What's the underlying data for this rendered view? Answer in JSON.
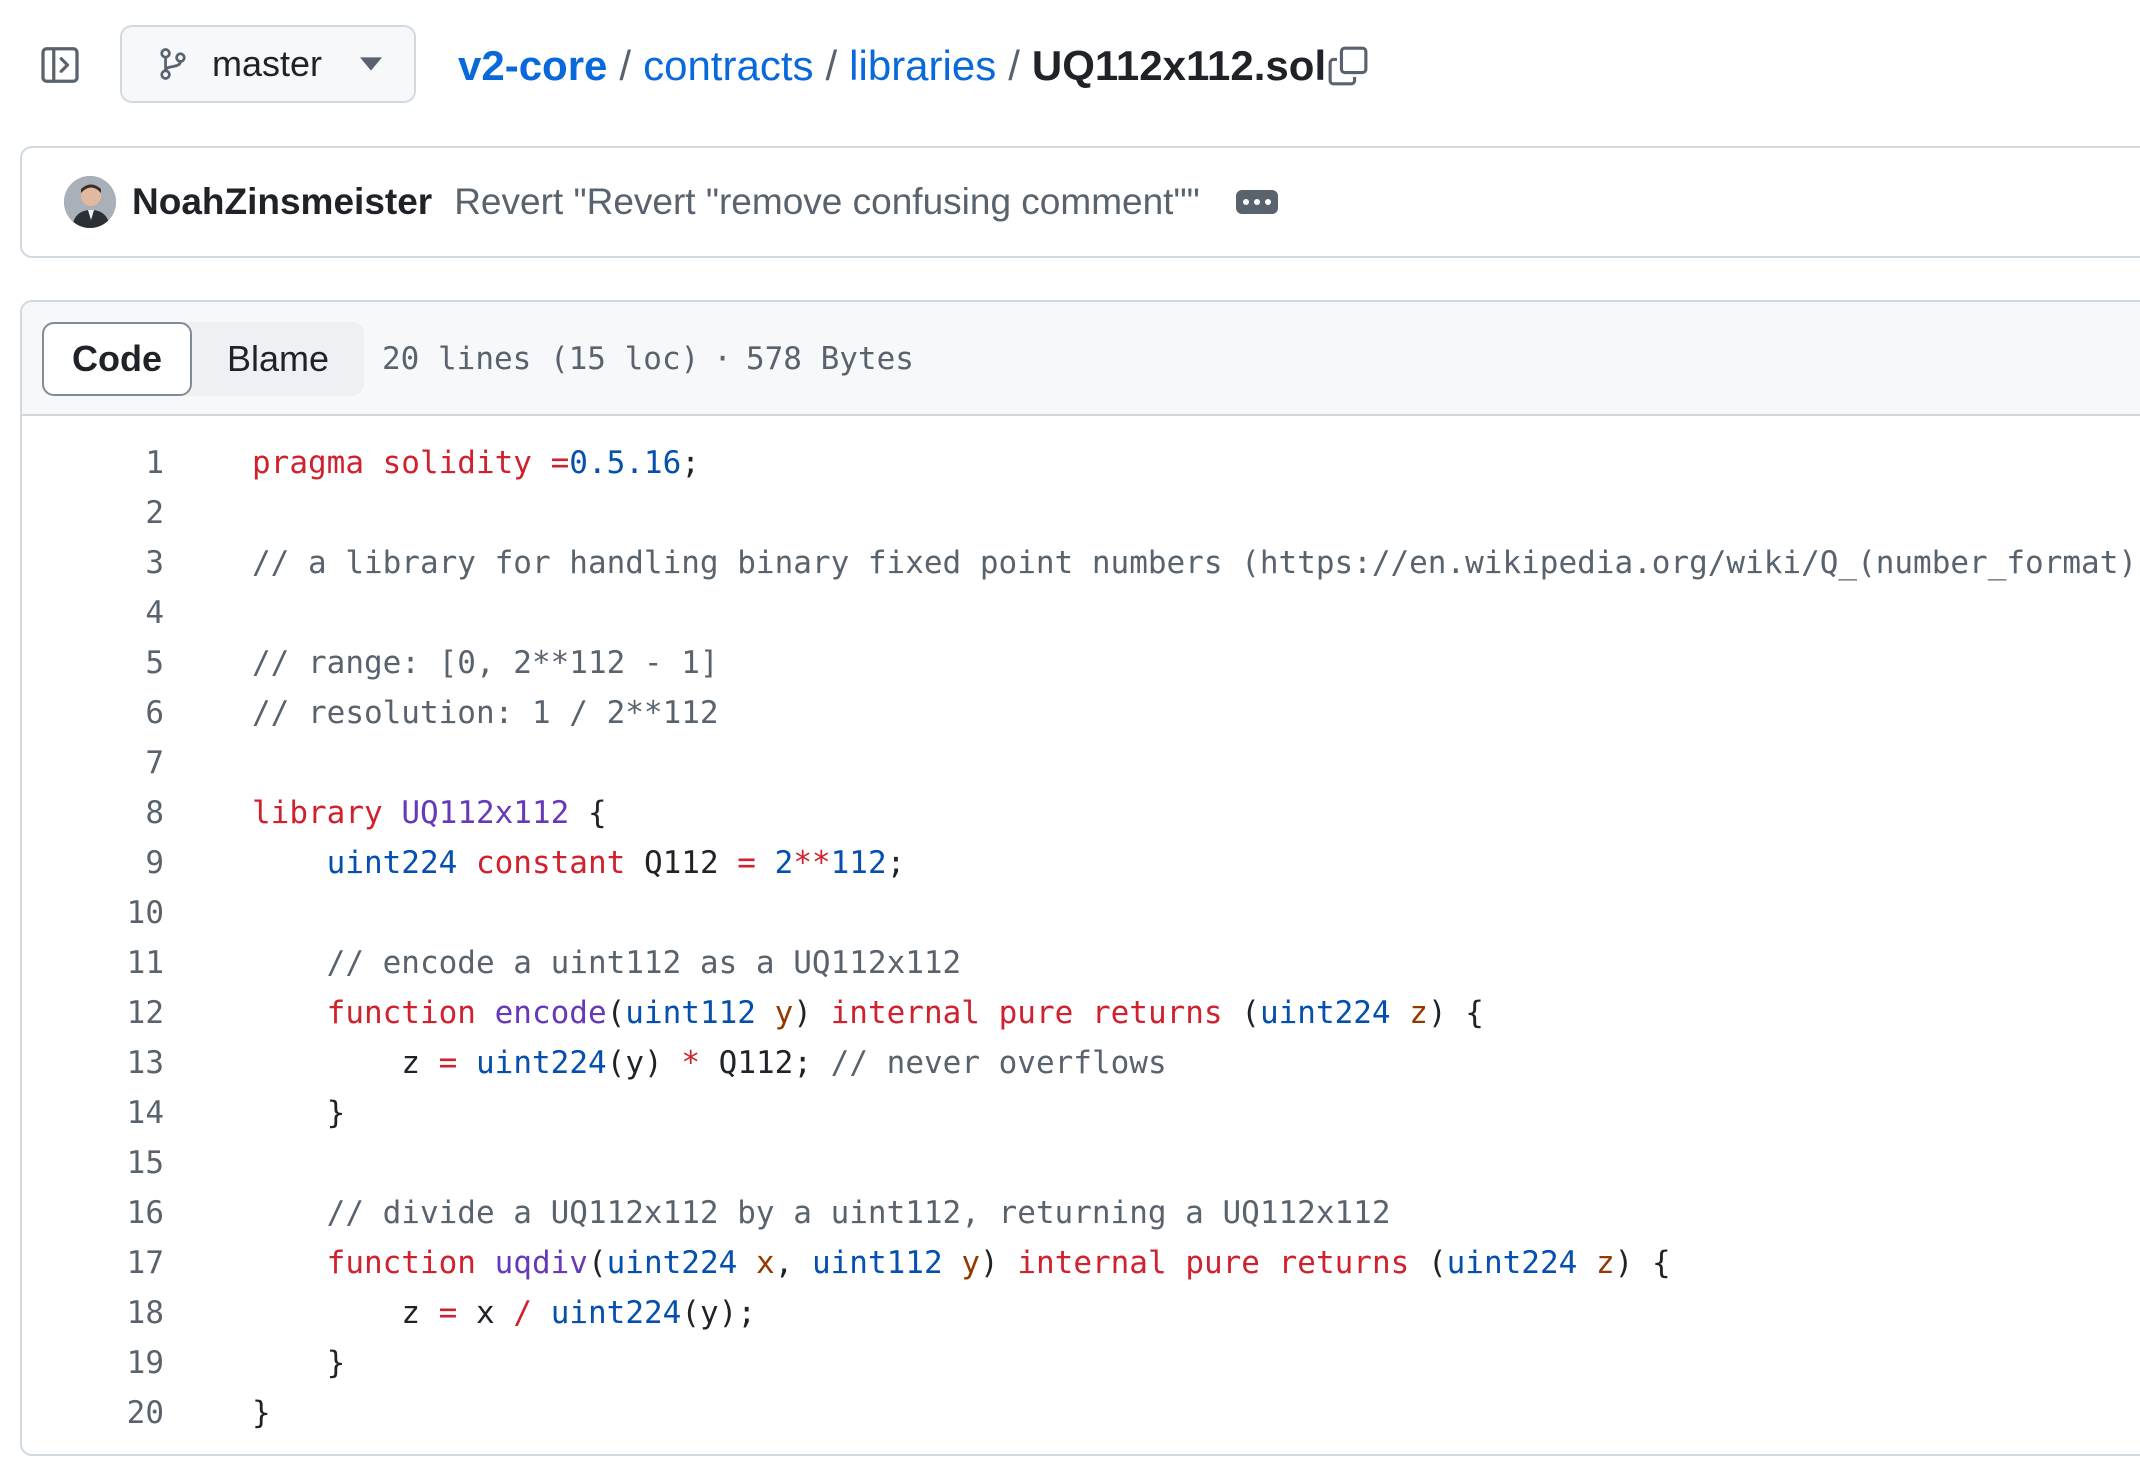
{
  "branch": {
    "name": "master"
  },
  "breadcrumb": {
    "repo": "v2-core",
    "dir1": "contracts",
    "dir2": "libraries",
    "file": "UQ112x112.sol",
    "separator": "/"
  },
  "commit": {
    "author": "NoahZinsmeister",
    "message": "Revert \"Revert \"remove confusing comment\"\""
  },
  "file": {
    "tabs": {
      "code": "Code",
      "blame": "Blame"
    },
    "lines_info": "20 lines (15 loc)",
    "dot": "·",
    "size": "578 Bytes"
  },
  "code": {
    "line_numbers": [
      "1",
      "2",
      "3",
      "4",
      "5",
      "6",
      "7",
      "8",
      "9",
      "10",
      "11",
      "12",
      "13",
      "14",
      "15",
      "16",
      "17",
      "18",
      "19",
      "20"
    ],
    "l1": {
      "a": "pragma solidity =",
      "b": "0.5.16",
      "c": ";"
    },
    "l3": "// a library for handling binary fixed point numbers (https://en.wikipedia.org/wiki/Q_(number_format))",
    "l5": "// range: [0, 2**112 - 1]",
    "l6": "// resolution: 1 / 2**112",
    "l8": {
      "kw": "library",
      "name": "UQ112x112",
      "brace": "{"
    },
    "l9": {
      "ty": "uint224",
      "kw": "constant",
      "name": "Q112",
      "eq": "=",
      "n1": "2",
      "op": "**",
      "n2": "112",
      "end": ";"
    },
    "l11": "// encode a uint112 as a UQ112x112",
    "l12": {
      "kw1": "function",
      "fn": "encode",
      "p1": "(",
      "ty1": "uint112",
      "v1": "y",
      "p2": ")",
      "kw2": "internal",
      "kw3": "pure",
      "kw4": "returns",
      "p3": "(",
      "ty2": "uint224",
      "v2": "z",
      "p4": ") {"
    },
    "l13": {
      "v": "z",
      "eq": "=",
      "ty": "uint224",
      "arg": "(y)",
      "op": "*",
      "rest": "Q112;",
      "cm": "// never overflows"
    },
    "l14": "}",
    "l16": "// divide a UQ112x112 by a uint112, returning a UQ112x112",
    "l17": {
      "kw1": "function",
      "fn": "uqdiv",
      "p1": "(",
      "ty1": "uint224",
      "v1": "x",
      "comma": ",",
      "ty2": "uint112",
      "v2": "y",
      "p2": ")",
      "kw2": "internal",
      "kw3": "pure",
      "kw4": "returns",
      "p3": "(",
      "ty3": "uint224",
      "v3": "z",
      "p4": ") {"
    },
    "l18": {
      "v": "z",
      "eq": "=",
      "x": "x",
      "op": "/",
      "ty": "uint224",
      "rest": "(y);"
    },
    "l19": "}",
    "l20": "}"
  },
  "colors": {
    "link": "#0969da",
    "keyword": "#cf222e",
    "type": "#0550ae",
    "function": "#6639ba",
    "comment": "#59636e",
    "param": "#953800"
  },
  "icons": {
    "sidebar": "sidebar-expand-icon",
    "branch": "git-branch-icon",
    "caret": "triangle-down-icon",
    "copy": "copy-icon",
    "more": "kebab-horizontal-icon"
  }
}
